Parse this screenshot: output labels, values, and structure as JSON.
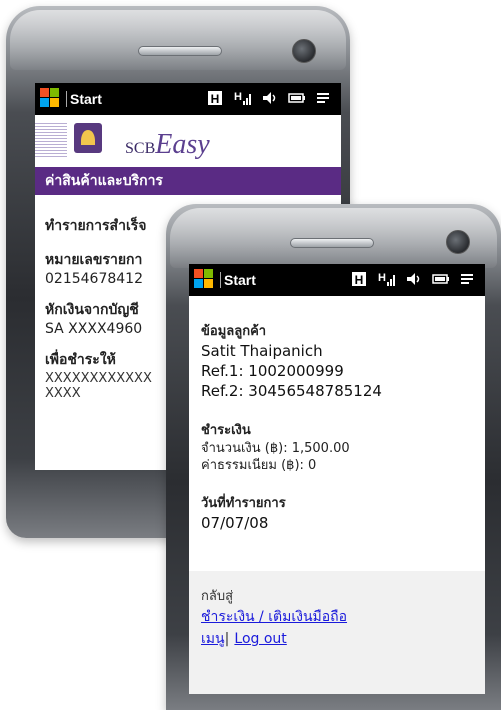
{
  "back": {
    "status": {
      "start_label": "Start"
    },
    "logo": {
      "brand_scb": "SCB",
      "brand_easy": "Easy"
    },
    "header": "ค่าสินค้าและบริการ",
    "sections": {
      "result": "ทำรายการสำเร็จ",
      "ref_label": "หมายเลขรายกา",
      "ref_value": "02154678412",
      "debit_label": "หักเงินจากบัญชี",
      "debit_value": "SA XXXX4960",
      "payto_label": "เพื่อชำระให้",
      "payto_value1": "XXXXXXXXXXXX",
      "payto_value2": "XXXX"
    }
  },
  "front": {
    "status": {
      "start_label": "Start"
    },
    "customer": {
      "label": "ข้อมูลลูกค้า",
      "name": "Satit Thaipanich",
      "ref1": "Ref.1: 1002000999",
      "ref2": "Ref.2: 30456548785124"
    },
    "payment": {
      "label": "ชำระเงิน",
      "amount": "จำนวนเงิน (฿): 1,500.00",
      "fee": "ค่าธรรมเนียม (฿): 0"
    },
    "date": {
      "label": "วันที่ทำรายการ",
      "value": "07/07/08"
    },
    "footer": {
      "back_label": "กลับสู่",
      "link_pay": "ชำระเงิน / เติมเงินมือถือ",
      "link_menu": "เมนู",
      "separator": "|",
      "link_logout": "Log out"
    }
  }
}
